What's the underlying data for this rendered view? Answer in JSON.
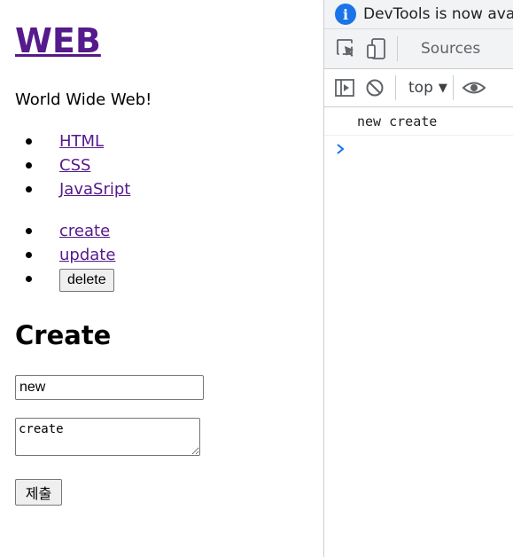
{
  "page": {
    "site_title": "WEB",
    "tagline": "World Wide Web!",
    "topics": [
      "HTML",
      "CSS",
      "JavaSript"
    ],
    "controls": {
      "create_label": "create",
      "update_label": "update",
      "delete_label": "delete"
    },
    "section_title": "Create",
    "form": {
      "title_value": "new",
      "body_value": "create",
      "submit_label": "제출"
    }
  },
  "devtools": {
    "infobar_text": "DevTools is now available in Korean",
    "tab_sources": "Sources",
    "context": "top",
    "console_log": "new create"
  },
  "colors": {
    "link_visited": "#551a8b",
    "info_blue": "#1a73e8"
  }
}
